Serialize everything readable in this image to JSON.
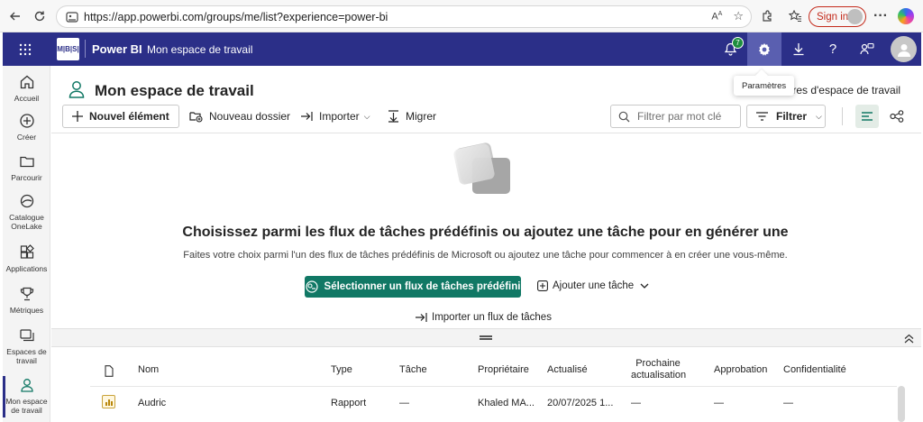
{
  "browser": {
    "url": "https://app.powerbi.com/groups/me/list?experience=power-bi",
    "signin_label": "Sign in"
  },
  "header": {
    "logo_text": "M|B|S|",
    "brand": "Power BI",
    "workspace": "Mon espace de travail",
    "notification_count": "7",
    "tooltip": "Paramètres"
  },
  "rail": {
    "items": [
      {
        "label": "Accueil",
        "icon": "home-icon"
      },
      {
        "label": "Créer",
        "icon": "plus-circle-icon"
      },
      {
        "label": "Parcourir",
        "icon": "folder-icon"
      },
      {
        "label": "Catalogue OneLake",
        "icon": "onelake-icon"
      },
      {
        "label": "Applications",
        "icon": "apps-icon"
      },
      {
        "label": "Métriques",
        "icon": "trophy-icon"
      },
      {
        "label": "Espaces de travail",
        "icon": "workspaces-icon"
      },
      {
        "label": "Mon espace de travail",
        "icon": "person-icon"
      }
    ]
  },
  "page": {
    "title": "Mon espace de travail",
    "settings_link": "tres d'espace de travail"
  },
  "toolbar": {
    "new_item": "Nouvel élément",
    "new_folder": "Nouveau dossier",
    "import": "Importer",
    "migrate": "Migrer",
    "search_placeholder": "Filtrer par mot clé",
    "filter": "Filtrer"
  },
  "empty_state": {
    "title": "Choisissez parmi les flux de tâches prédéfinis ou ajoutez une tâche pour en générer une",
    "subtitle": "Faites votre choix parmi l'un des flux de tâches prédéfinis de Microsoft ou ajoutez une tâche pour commencer à en créer une vous-même.",
    "primary_button": "Sélectionner un flux de tâches prédéfini",
    "add_task": "Ajouter une tâche",
    "import_flow": "Importer un flux de tâches"
  },
  "table": {
    "columns": {
      "name": "Nom",
      "type": "Type",
      "task": "Tâche",
      "owner": "Propriétaire",
      "updated": "Actualisé",
      "next_refresh_1": "Prochaine",
      "next_refresh_2": "actualisation",
      "approval": "Approbation",
      "confidentiality": "Confidentialité"
    },
    "rows": [
      {
        "name": "Audric",
        "type": "Rapport",
        "task": "—",
        "owner": "Khaled MA...",
        "updated": "20/07/2025 1...",
        "next_refresh": "—",
        "approval": "—",
        "confidentiality": "—"
      }
    ]
  },
  "colors": {
    "header_bg": "#2b2f88",
    "primary": "#117865",
    "signin": "#c42b1c"
  }
}
